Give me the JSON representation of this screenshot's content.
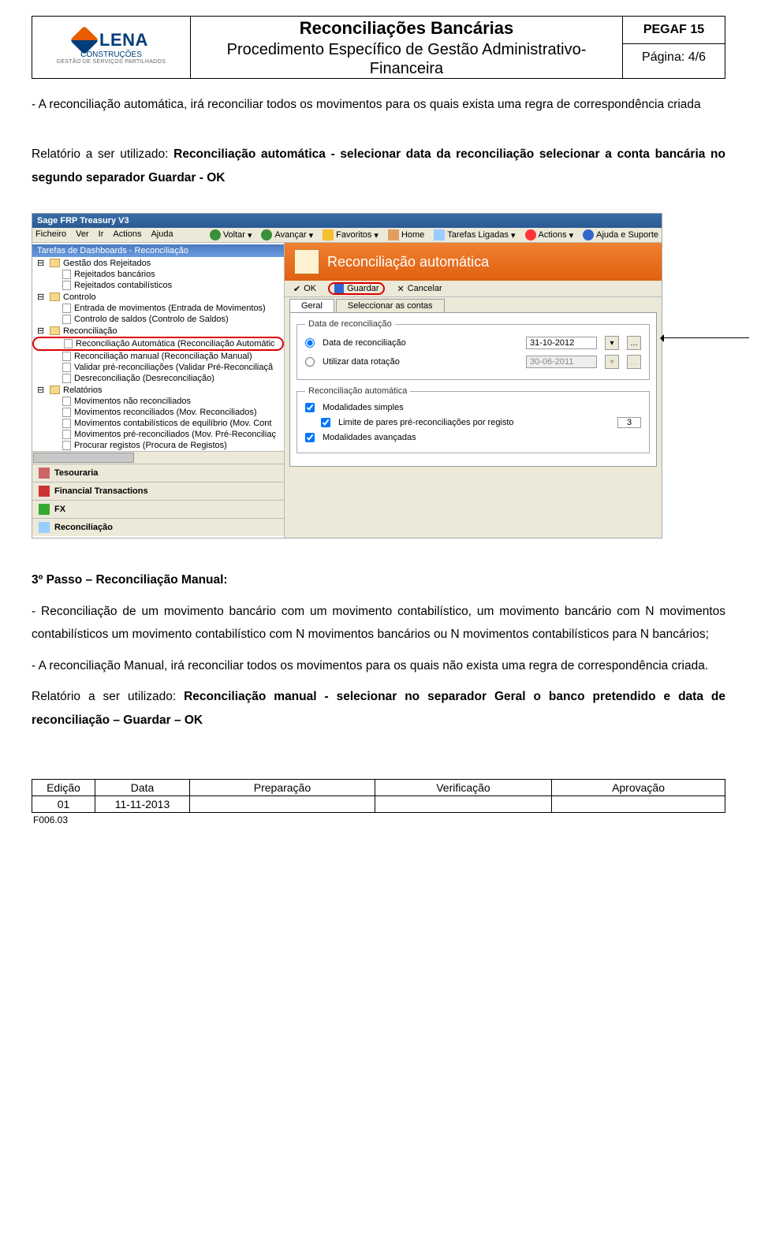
{
  "header": {
    "logo_main": "LENA",
    "logo_sub": "CONSTRUÇÕES",
    "logo_small": "GESTÃO DE SERVIÇOS PARTILHADOS",
    "title": "Reconciliações Bancárias",
    "subtitle": "Procedimento Específico de Gestão Administrativo-Financeira",
    "code": "PEGAF 15",
    "page": "Página: 4/6"
  },
  "intro": {
    "p1": "- A reconciliação automática, irá reconciliar todos os movimentos para os quais exista uma regra de correspondência criada",
    "p2a": "Relatório a ser utilizado: ",
    "p2b": "Reconciliação automática - selecionar data da reconciliação selecionar a conta bancária no segundo separador Guardar - OK"
  },
  "screenshot": {
    "app_title": "Sage FRP Treasury V3",
    "menu": [
      "Ficheiro",
      "Ver",
      "Ir",
      "Actions",
      "Ajuda"
    ],
    "toolbar": {
      "voltar": "Voltar",
      "avancar": "Avançar",
      "favoritos": "Favoritos",
      "home": "Home",
      "tarefas": "Tarefas Ligadas",
      "actions": "Actions",
      "ajuda": "Ajuda e Suporte"
    },
    "tree_title": "Tarefas de Dashboards - Reconciliação",
    "tree": [
      {
        "t": "Gestão dos Rejeitados",
        "lvl": 1,
        "folder": true
      },
      {
        "t": "Rejeitados bancários",
        "lvl": 2
      },
      {
        "t": "Rejeitados contabilísticos",
        "lvl": 2
      },
      {
        "t": "Controlo",
        "lvl": 1,
        "folder": true
      },
      {
        "t": "Entrada de movimentos (Entrada de Movimentos)",
        "lvl": 2
      },
      {
        "t": "Controlo de saldos (Controlo de Saldos)",
        "lvl": 2
      },
      {
        "t": "Reconciliação",
        "lvl": 1,
        "folder": true
      },
      {
        "t": "Reconciliação Automática (Reconciliação Automátic",
        "lvl": 2,
        "sel": true
      },
      {
        "t": "Reconciliação manual (Reconciliação Manual)",
        "lvl": 2
      },
      {
        "t": "Validar pré-reconciliações (Validar Pré-Reconciliaçã",
        "lvl": 2
      },
      {
        "t": "Desreconciliação (Desreconciliação)",
        "lvl": 2
      },
      {
        "t": "Relatórios",
        "lvl": 1,
        "folder": true
      },
      {
        "t": "Movimentos não reconciliados",
        "lvl": 2
      },
      {
        "t": "Movimentos reconciliados (Mov. Reconciliados)",
        "lvl": 2
      },
      {
        "t": "Movimentos contabilísticos de equilíbrio (Mov. Cont",
        "lvl": 2
      },
      {
        "t": "Movimentos pré-reconciliados (Mov. Pré-Reconciliaç",
        "lvl": 2
      },
      {
        "t": "Procurar registos (Procura de Registos)",
        "lvl": 2
      }
    ],
    "panes": [
      "Tesouraria",
      "Financial Transactions",
      "FX",
      "Reconciliação"
    ],
    "main_title": "Reconciliação automática",
    "actions": {
      "ok": "OK",
      "guardar": "Guardar",
      "cancelar": "Cancelar"
    },
    "tabs": {
      "geral": "Geral",
      "contas": "Seleccionar as contas"
    },
    "fs1": {
      "legend": "Data de reconciliação",
      "opt1": "Data de reconciliação",
      "opt2": "Utilizar data rotação",
      "date1": "31-10-2012",
      "date2": "30-06-2011"
    },
    "fs2": {
      "legend": "Reconciliação automática",
      "chk1": "Modalidades simples",
      "chk2": "Limite de pares pré-reconciliações por registo",
      "chk3": "Modalidades avançadas",
      "limit": "3"
    }
  },
  "passo3": {
    "title": "3º Passo – Reconciliação Manual:",
    "p1": "- Reconciliação de um movimento bancário com um movimento contabilístico, um movimento bancário com N movimentos contabilísticos um movimento contabilístico com N movimentos bancários ou N movimentos contabilísticos para N bancários;",
    "p2": "- A reconciliação Manual, irá reconciliar todos os movimentos para os quais não exista uma regra de correspondência criada.",
    "p3a": "Relatório a ser utilizado: ",
    "p3b": "Reconciliação manual - selecionar no separador Geral o banco pretendido e data de reconciliação – Guardar – OK"
  },
  "footer": {
    "h1": "Edição",
    "h2": "Data",
    "h3": "Preparação",
    "h4": "Verificação",
    "h5": "Aprovação",
    "v1": "01",
    "v2": "11-11-2013",
    "code": "F006.03"
  }
}
